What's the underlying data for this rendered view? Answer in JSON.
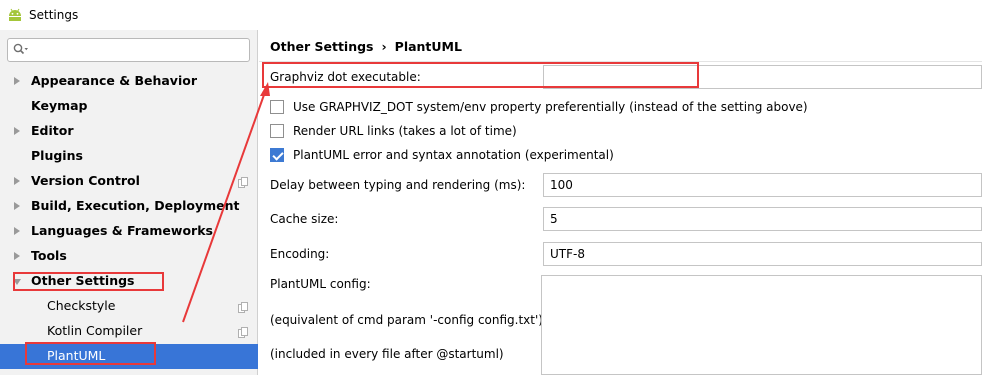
{
  "window": {
    "title": "Settings",
    "app_icon": "android-icon"
  },
  "search": {
    "value": "",
    "placeholder": ""
  },
  "sidebar": {
    "items": [
      {
        "label": "Appearance & Behavior",
        "arrow": "right"
      },
      {
        "label": "Keymap",
        "arrow": "none"
      },
      {
        "label": "Editor",
        "arrow": "right"
      },
      {
        "label": "Plugins",
        "arrow": "none"
      },
      {
        "label": "Version Control",
        "arrow": "right",
        "icon": "copy-icon"
      },
      {
        "label": "Build, Execution, Deployment",
        "arrow": "right"
      },
      {
        "label": "Languages & Frameworks",
        "arrow": "right"
      },
      {
        "label": "Tools",
        "arrow": "right"
      },
      {
        "label": "Other Settings",
        "arrow": "down"
      },
      {
        "label": "Checkstyle",
        "arrow": "none",
        "icon": "copy-icon"
      },
      {
        "label": "Kotlin Compiler",
        "arrow": "none",
        "icon": "copy-icon"
      },
      {
        "label": "PlantUML",
        "arrow": "none",
        "selected": true
      }
    ]
  },
  "breadcrumb": {
    "parent": "Other Settings",
    "separator": "›",
    "current": "PlantUML"
  },
  "content": {
    "graphviz_label": "Graphviz dot executable:",
    "graphviz_value": "",
    "checkbox_env": {
      "label": "Use GRAPHVIZ_DOT system/env property preferentially (instead of the setting above)",
      "checked": false
    },
    "checkbox_url": {
      "label": "Render URL links (takes a lot of time)",
      "checked": false
    },
    "checkbox_annot": {
      "label": "PlantUML error and syntax annotation (experimental)",
      "checked": true
    },
    "delay_label": "Delay between typing and rendering (ms):",
    "delay_value": "100",
    "cache_label": "Cache size:",
    "cache_value": "5",
    "encoding_label": "Encoding:",
    "encoding_value": "UTF-8",
    "config_label": "PlantUML config:",
    "config_hint1": "(equivalent of cmd param '-config config.txt')",
    "config_hint2": "(included in every file after @startuml)"
  },
  "colors": {
    "selection": "#3875d7",
    "annotation_red": "#e8393a",
    "checkbox_checked": "#3d7ad3"
  }
}
